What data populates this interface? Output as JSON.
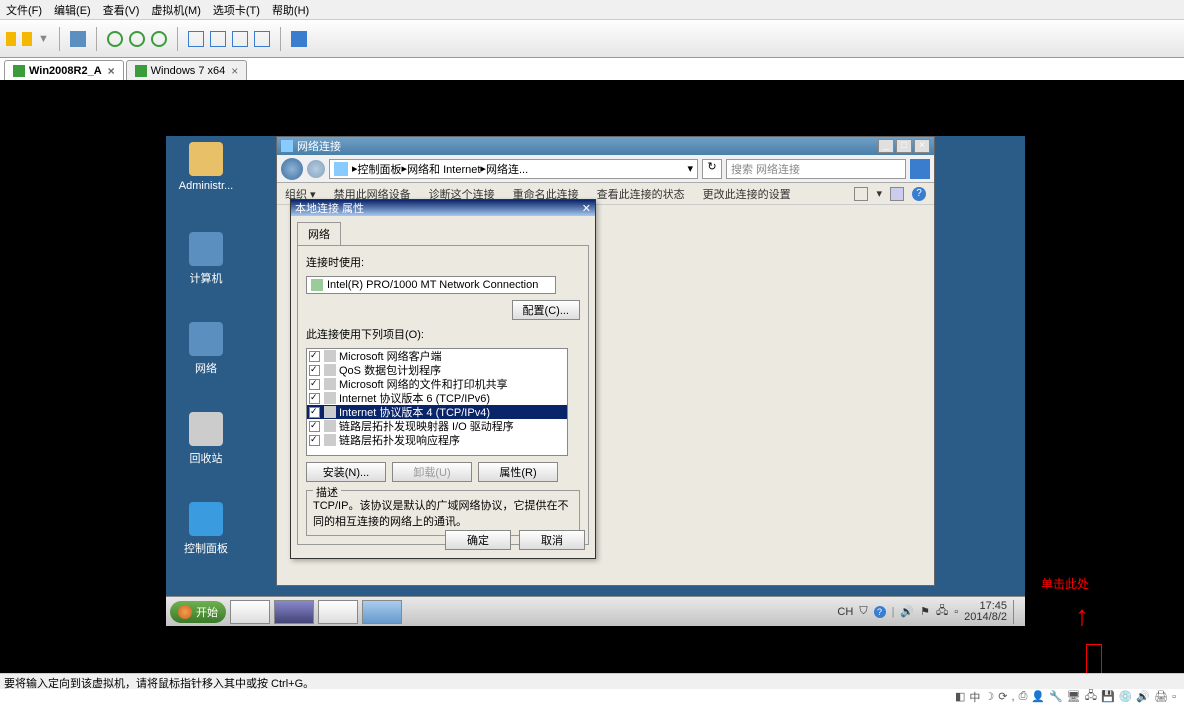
{
  "host": {
    "menu": {
      "file": "文件(F)",
      "edit": "编辑(E)",
      "view": "查看(V)",
      "vm": "虚拟机(M)",
      "tabs": "选项卡(T)",
      "help": "帮助(H)"
    },
    "tabs": {
      "active": "Win2008R2_A",
      "inactive": "Windows 7 x64"
    },
    "status": "要将输入定向到该虚拟机，请将鼠标指针移入其中或按 Ctrl+G。",
    "tray_cn": "中"
  },
  "guest": {
    "desktop_icons": {
      "admin": "Administr...",
      "computer": "计算机",
      "network": "网络",
      "recycle": "回收站",
      "cpanel": "控制面板"
    },
    "win_network": {
      "title": "网络连接",
      "breadcrumb": {
        "a": "控制面板",
        "b": "网络和 Internet",
        "c": "网络连...",
        "sep": " ▸ "
      },
      "search_placeholder": "搜索 网络连接",
      "cmdbar": {
        "org": "组织 ▾",
        "disable": "禁用此网络设备",
        "diag": "诊断这个连接",
        "rename": "重命名此连接",
        "status": "查看此连接的状态",
        "settings": "更改此连接的设置"
      }
    },
    "dlg": {
      "title": "本地连接 属性",
      "tab": "网络",
      "connect_using": "连接时使用:",
      "adapter": "Intel(R) PRO/1000 MT Network Connection",
      "configure": "配置(C)...",
      "items_label": "此连接使用下列项目(O):",
      "items": [
        {
          "label": "Microsoft 网络客户端"
        },
        {
          "label": "QoS 数据包计划程序"
        },
        {
          "label": "Microsoft 网络的文件和打印机共享"
        },
        {
          "label": "Internet 协议版本 6 (TCP/IPv6)"
        },
        {
          "label": "Internet 协议版本 4 (TCP/IPv4)",
          "selected": true
        },
        {
          "label": "链路层拓扑发现映射器 I/O 驱动程序"
        },
        {
          "label": "链路层拓扑发现响应程序"
        }
      ],
      "btn_install": "安装(N)...",
      "btn_uninstall": "卸载(U)",
      "btn_props": "属性(R)",
      "desc_title": "描述",
      "desc_text": "TCP/IP。该协议是默认的广域网络协议，它提供在不同的相互连接的网络上的通讯。",
      "ok": "确定",
      "cancel": "取消"
    },
    "taskbar": {
      "start": "开始",
      "lang": "CH",
      "time": "17:45",
      "date": "2014/8/2"
    }
  },
  "annotation": {
    "text": "单击此处"
  }
}
